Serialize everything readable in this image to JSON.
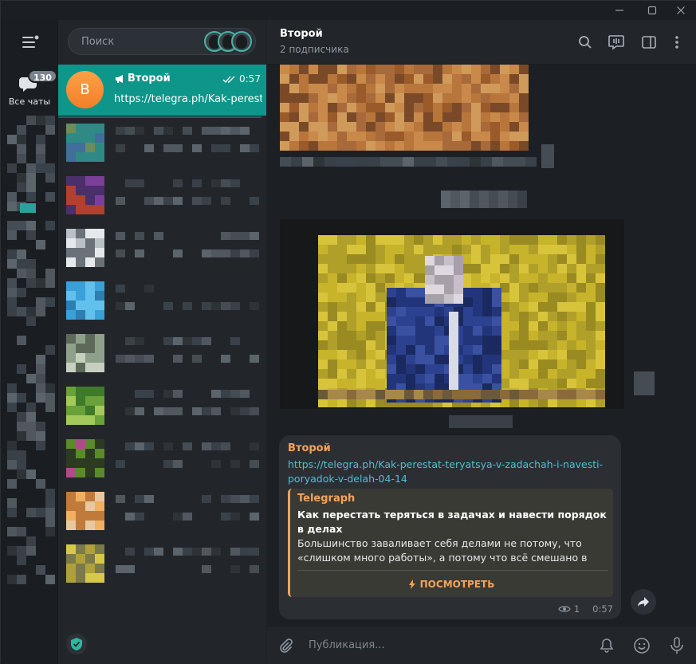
{
  "rail": {
    "folder_all": {
      "label": "Все чаты",
      "badge": "130"
    }
  },
  "search": {
    "placeholder": "Поиск"
  },
  "active_chat": {
    "avatar_letter": "В",
    "name": "Второй",
    "time": "0:57",
    "preview": "https://telegra.ph/Kak-perestat-teryatsya"
  },
  "header": {
    "title": "Второй",
    "subtitle": "2 подписчика"
  },
  "message": {
    "author": "Второй",
    "link": "https://telegra.ph/Kak-perestat-teryatsya-v-zadachah-i-navesti-poryadok-v-delah-04-14",
    "preview": {
      "site": "Telegraph",
      "title": "Как перестать теряться в задачах и навести порядок в делах",
      "description": "Большинство заваливает себя делами не потому, что «слишком много работы», а потому что всё смешано в одну ...",
      "button": "ПОСМОТРЕТЬ"
    },
    "views": "1",
    "time": "0:57"
  },
  "composer": {
    "placeholder": "Публикация..."
  },
  "colors": {
    "accent": "#0e968a",
    "author": "#f4a35b",
    "link": "#4fbfd2",
    "avatar": "#f68b33"
  },
  "icons": [
    "menu-icon",
    "chat-bubble-icon",
    "channel-icon",
    "double-check-icon",
    "search-icon",
    "livestream-icon",
    "sidebar-icon",
    "more-icon",
    "eye-icon",
    "forward-icon",
    "attach-icon",
    "bell-icon",
    "emoji-icon",
    "mic-icon",
    "shield-icon"
  ]
}
